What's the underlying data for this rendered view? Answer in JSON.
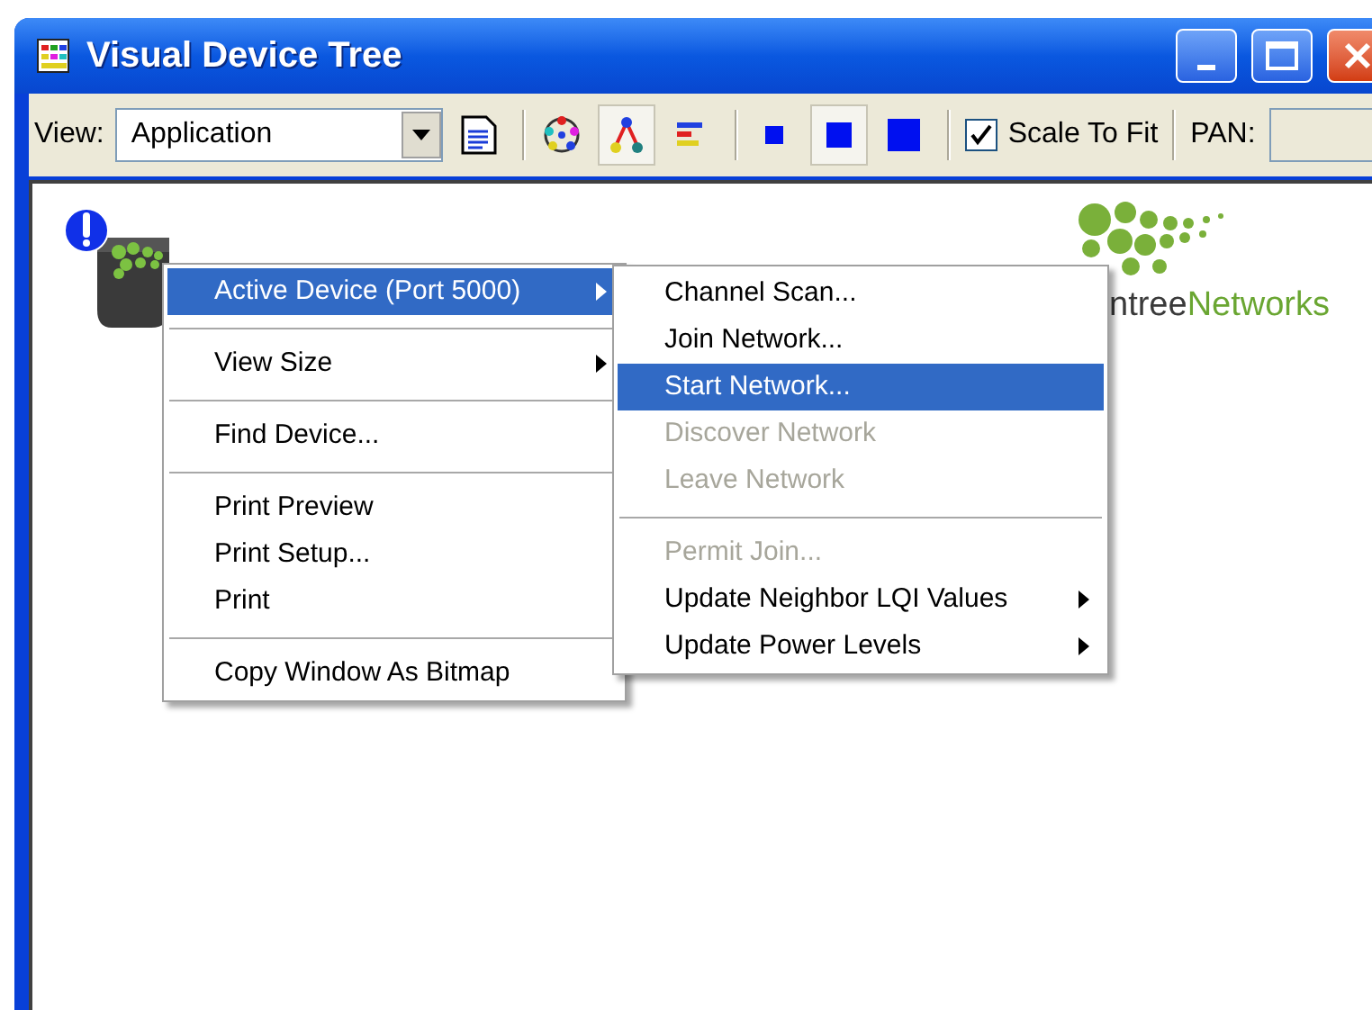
{
  "window": {
    "title": "Visual Device Tree"
  },
  "toolbar": {
    "view_label": "View:",
    "view_value": "Application",
    "buttons": [
      {
        "kind": "document",
        "selected": false
      },
      {
        "kind": "circle",
        "selected": false
      },
      {
        "kind": "tree",
        "selected": true
      },
      {
        "kind": "bars",
        "selected": false
      },
      {
        "kind": "small",
        "selected": false
      },
      {
        "kind": "medium",
        "selected": true
      },
      {
        "kind": "large",
        "selected": false
      }
    ],
    "scale_to_fit": {
      "label": "Scale To Fit",
      "checked": true
    },
    "pan_label": "PAN:"
  },
  "logo": {
    "parts": [
      {
        "text": "ntree",
        "color": "#3a3a3a"
      },
      {
        "text": "Networks",
        "color": "#6aa632"
      }
    ]
  },
  "context_menu": {
    "items": [
      {
        "kind": "item",
        "label": "Active Device (Port 5000)",
        "submenu": true,
        "selected": true,
        "disabled": false
      },
      {
        "kind": "separator"
      },
      {
        "kind": "item",
        "label": "View Size",
        "submenu": true,
        "selected": false,
        "disabled": false
      },
      {
        "kind": "separator"
      },
      {
        "kind": "item",
        "label": "Find Device...",
        "submenu": false,
        "selected": false,
        "disabled": false
      },
      {
        "kind": "separator"
      },
      {
        "kind": "item",
        "label": "Print Preview",
        "submenu": false,
        "selected": false,
        "disabled": false
      },
      {
        "kind": "item",
        "label": "Print Setup...",
        "submenu": false,
        "selected": false,
        "disabled": false
      },
      {
        "kind": "item",
        "label": "Print",
        "submenu": false,
        "selected": false,
        "disabled": false
      },
      {
        "kind": "separator"
      },
      {
        "kind": "item",
        "label": "Copy Window As Bitmap",
        "submenu": false,
        "selected": false,
        "disabled": false
      }
    ]
  },
  "submenu": {
    "items": [
      {
        "kind": "item",
        "label": "Channel Scan...",
        "submenu": false,
        "selected": false,
        "disabled": false
      },
      {
        "kind": "item",
        "label": "Join Network...",
        "submenu": false,
        "selected": false,
        "disabled": false
      },
      {
        "kind": "item",
        "label": "Start Network...",
        "submenu": false,
        "selected": true,
        "disabled": false
      },
      {
        "kind": "item",
        "label": "Discover Network",
        "submenu": false,
        "selected": false,
        "disabled": true
      },
      {
        "kind": "item",
        "label": "Leave Network",
        "submenu": false,
        "selected": false,
        "disabled": true
      },
      {
        "kind": "separator"
      },
      {
        "kind": "item",
        "label": "Permit Join...",
        "submenu": false,
        "selected": false,
        "disabled": true
      },
      {
        "kind": "item",
        "label": "Update Neighbor LQI Values",
        "submenu": true,
        "selected": false,
        "disabled": false
      },
      {
        "kind": "item",
        "label": "Update Power Levels",
        "submenu": true,
        "selected": false,
        "disabled": false
      }
    ]
  }
}
